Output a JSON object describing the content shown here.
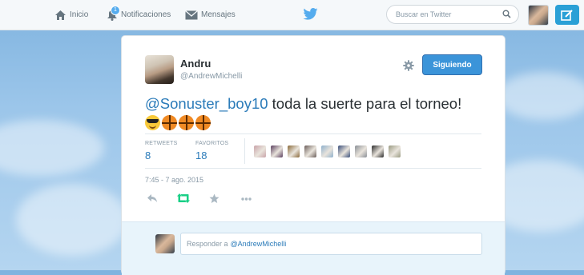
{
  "nav": {
    "home_label": "Inicio",
    "notifications_label": "Notificaciones",
    "notifications_badge": "1",
    "messages_label": "Mensajes",
    "search_placeholder": "Buscar en Twitter"
  },
  "tweet": {
    "author_name": "Andru",
    "author_handle": "@AndrewMichelli",
    "follow_label": "Siguiendo",
    "mention": "@Sonuster_boy10",
    "text_after_mention": " toda la suerte para el torneo! ",
    "emojis": [
      "cool-sunglasses-emoji",
      "basketball-emoji",
      "basketball-emoji",
      "basketball-emoji"
    ],
    "retweets_label": "RETWEETS",
    "retweets_count": "8",
    "favorites_label": "FAVORITOS",
    "favorites_count": "18",
    "favoriter_avatar_colors": [
      "#c9a3a8",
      "#5a3f5e",
      "#8a6a3a",
      "#6b5e5a",
      "#8fb0cc",
      "#3a4f7a",
      "#8a8f96",
      "#2a2a2a",
      "#9a9a82"
    ],
    "timestamp": "7:45 - 7 ago. 2015",
    "actions": [
      "reply-icon",
      "retweet-icon",
      "favorite-icon",
      "more-icon"
    ]
  },
  "reply": {
    "prefix": "Responder a",
    "mention": "@AndrewMichelli"
  },
  "colors": {
    "accent": "#55acee",
    "link": "#2b7bb9",
    "follow_button": "#3b94d9",
    "retweet_green": "#19cf86",
    "topbar": "#f5f8fa"
  }
}
